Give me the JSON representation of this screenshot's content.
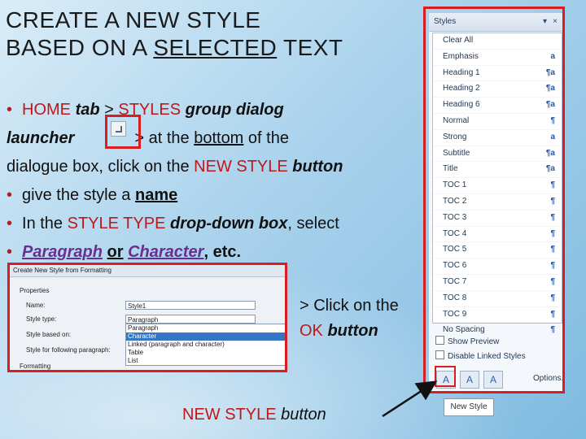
{
  "title": {
    "line1": "CREATE A NEW STYLE",
    "line2_prefix": "BASED ON A ",
    "line2_underlined": "SELECTED",
    "line2_suffix": " TEXT"
  },
  "instructions": {
    "bullet1_home": "HOME",
    "bullet1_tab": "tab",
    "bullet1_gt1": " > ",
    "bullet1_styles": "STYLES",
    "bullet1_group": "group dialog",
    "bullet1_launcher": "launcher",
    "bullet1_gt2": "> at the ",
    "bullet1_bottom": "bottom",
    "bullet1_ofthe": " of the",
    "bullet1_dialogue": "dialogue box, click on the ",
    "bullet1_newstyle": "NEW STYLE",
    "bullet1_button": "button",
    "bullet2_prefix": "give the style a ",
    "bullet2_name": "name",
    "bullet3_prefix": "In the ",
    "bullet3_styletype": "STYLE TYPE",
    "bullet3_dropdown": "drop-down box",
    "bullet3_suffix": ", select",
    "bullet4_paragraph": "Paragraph",
    "bullet4_or": "or",
    "bullet4_character": "Character",
    "bullet4_etc": ", etc."
  },
  "ok_note": {
    "line1": "> Click on the",
    "ok": "OK",
    "button": "button"
  },
  "new_style_caption": {
    "label": "NEW STYLE",
    "button": "button"
  },
  "dialog": {
    "title": "Create New Style from Formatting",
    "section_properties": "Properties",
    "name_label": "Name:",
    "name_value": "Style1",
    "style_type_label": "Style type:",
    "style_type_value": "Paragraph",
    "style_based_label": "Style based on:",
    "style_following_label": "Style for following paragraph:",
    "section_formatting": "Formatting",
    "options": [
      "Paragraph",
      "Character",
      "Linked (paragraph and character)",
      "Table",
      "List"
    ],
    "selected_option": "Character"
  },
  "styles_pane": {
    "title": "Styles",
    "items": [
      {
        "label": "Clear All",
        "mark": ""
      },
      {
        "label": "Emphasis",
        "mark": "a"
      },
      {
        "label": "Heading 1",
        "mark": "¶a"
      },
      {
        "label": "Heading 2",
        "mark": "¶a"
      },
      {
        "label": "Heading 6",
        "mark": "¶a"
      },
      {
        "label": "Normal",
        "mark": "¶"
      },
      {
        "label": "Strong",
        "mark": "a"
      },
      {
        "label": "Subtitle",
        "mark": "¶a"
      },
      {
        "label": "Title",
        "mark": "¶a"
      },
      {
        "label": "TOC 1",
        "mark": "¶"
      },
      {
        "label": "TOC 2",
        "mark": "¶"
      },
      {
        "label": "TOC 3",
        "mark": "¶"
      },
      {
        "label": "TOC 4",
        "mark": "¶"
      },
      {
        "label": "TOC 5",
        "mark": "¶"
      },
      {
        "label": "TOC 6",
        "mark": "¶"
      },
      {
        "label": "TOC 7",
        "mark": "¶"
      },
      {
        "label": "TOC 8",
        "mark": "¶"
      },
      {
        "label": "TOC 9",
        "mark": "¶"
      },
      {
        "label": "No Spacing",
        "mark": "¶"
      }
    ],
    "show_preview": "Show Preview",
    "disable_linked": "Disable Linked Styles",
    "options_link": "Options...",
    "tooltip": "New Style"
  }
}
